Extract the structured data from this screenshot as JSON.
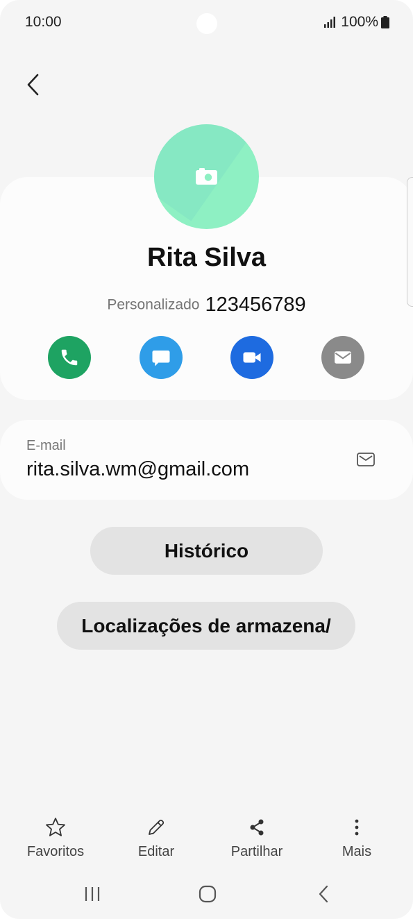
{
  "status_bar": {
    "time": "10:00",
    "battery": "100%"
  },
  "contact": {
    "name": "Rita Silva",
    "phone_type": "Personalizado",
    "phone_number": "123456789"
  },
  "actions": [
    {
      "name": "call",
      "icon": "phone-icon",
      "color": "#1ea362"
    },
    {
      "name": "message",
      "icon": "message-icon",
      "color": "#2f9de8"
    },
    {
      "name": "video",
      "icon": "video-icon",
      "color": "#1e6be0"
    },
    {
      "name": "email",
      "icon": "mail-icon",
      "color": "#8a8a8a"
    }
  ],
  "email": {
    "label": "E-mail",
    "value": "rita.silva.wm@gmail.com"
  },
  "buttons": {
    "history": "Histórico",
    "storage": "Localizações de armazena/"
  },
  "bottom_nav": {
    "favorites": "Favoritos",
    "edit": "Editar",
    "share": "Partilhar",
    "more": "Mais"
  },
  "colors": {
    "avatar": "#8ef0c3",
    "background": "#f5f5f5",
    "card": "#fcfcfc",
    "pill": "#e3e3e3"
  }
}
